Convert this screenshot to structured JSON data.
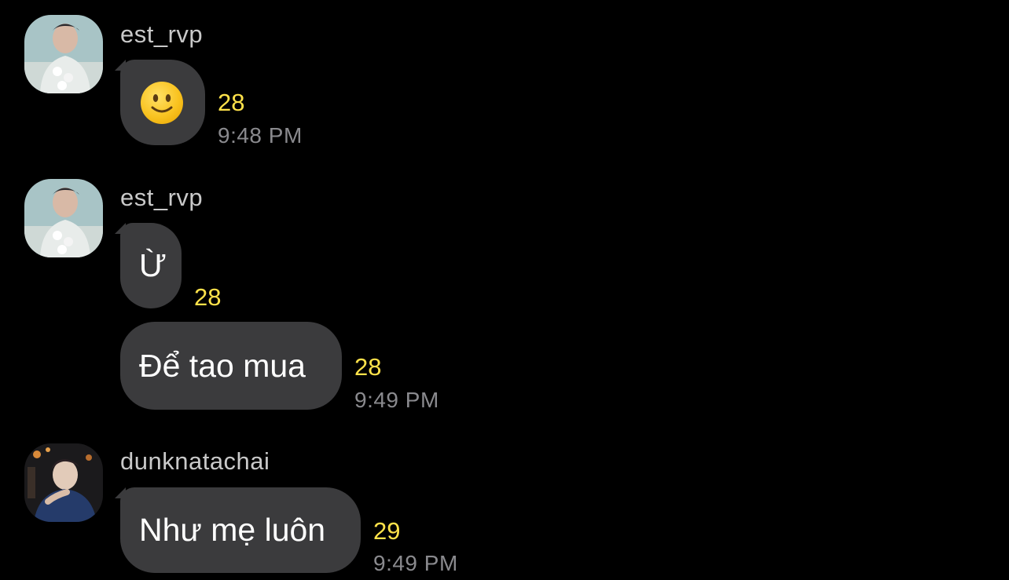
{
  "messages": [
    {
      "sender": "est_rvp",
      "text": "🙂",
      "emoji": "slightly-smiling-face",
      "count": "28",
      "time": "9:48 PM"
    },
    {
      "sender": "est_rvp",
      "text": "Ừ",
      "count": "28"
    },
    {
      "text": "Để tao mua",
      "count": "28",
      "time": "9:49 PM"
    },
    {
      "sender": "dunknatachai",
      "text": "Như mẹ luôn",
      "count": "29",
      "time": "9:49 PM"
    }
  ],
  "colors": {
    "background": "#000000",
    "bubble": "#3b3b3d",
    "count": "#ffe24a",
    "sender": "#c9c9c9",
    "time": "#8a8a8e"
  }
}
